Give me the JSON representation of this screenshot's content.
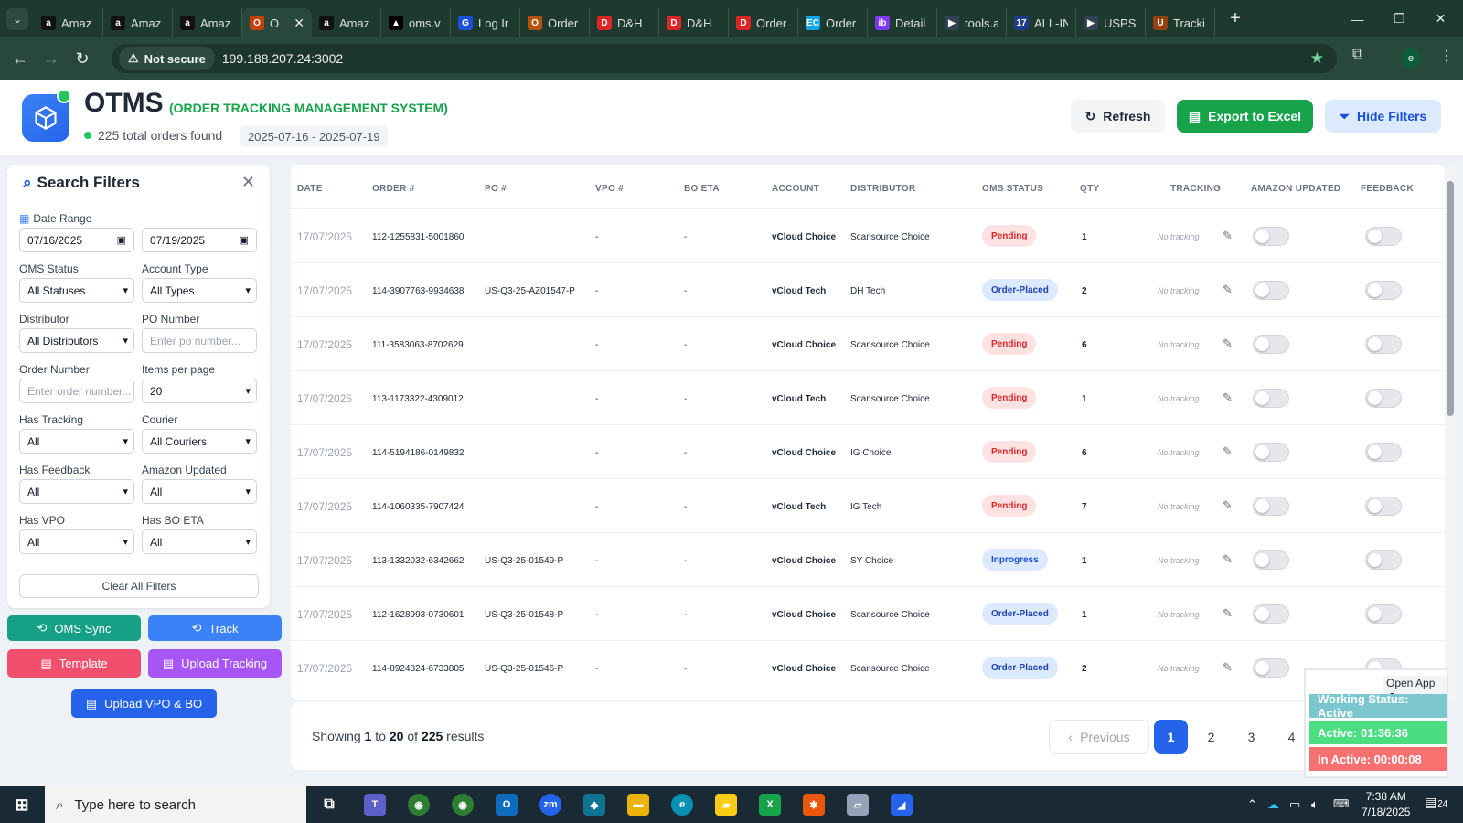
{
  "browser": {
    "tabs": [
      {
        "title": "Amaz",
        "icon": "amazon-icon",
        "color": "#111111",
        "glyph": "a"
      },
      {
        "title": "Amaz",
        "icon": "amazon-icon",
        "color": "#111111",
        "glyph": "a"
      },
      {
        "title": "Amaz",
        "icon": "amazon-icon",
        "color": "#111111",
        "glyph": "a"
      },
      {
        "title": "O",
        "icon": "otms-icon",
        "color": "#c2410c",
        "glyph": "O",
        "active": true
      },
      {
        "title": "Amaz",
        "icon": "amazon-icon",
        "color": "#111111",
        "glyph": "a"
      },
      {
        "title": "oms.v",
        "icon": "vercel-icon",
        "color": "#000000",
        "glyph": "▲"
      },
      {
        "title": "Log Ir",
        "icon": "login-icon",
        "color": "#1d4ed8",
        "glyph": "G"
      },
      {
        "title": "Order",
        "icon": "order-icon",
        "color": "#b45309",
        "glyph": "O"
      },
      {
        "title": "D&H",
        "icon": "dh-icon",
        "color": "#dc2626",
        "glyph": "D"
      },
      {
        "title": "D&H",
        "icon": "dh-icon",
        "color": "#dc2626",
        "glyph": "D"
      },
      {
        "title": "Order",
        "icon": "order-icon",
        "color": "#dc2626",
        "glyph": "D"
      },
      {
        "title": "Order",
        "icon": "ec-icon",
        "color": "#0ea5e9",
        "glyph": "EC"
      },
      {
        "title": "Detail",
        "icon": "detail-icon",
        "color": "#7c3aed",
        "glyph": "ib"
      },
      {
        "title": "tools.a",
        "icon": "tools-icon",
        "color": "#334155",
        "glyph": "▶"
      },
      {
        "title": "ALL-IN",
        "icon": "allin-icon",
        "color": "#1e3a8a",
        "glyph": "17"
      },
      {
        "title": "USPS.",
        "icon": "usps-icon",
        "color": "#334155",
        "glyph": "▶"
      },
      {
        "title": "Tracki",
        "icon": "ups-icon",
        "color": "#92400e",
        "glyph": "U"
      }
    ],
    "new_tab": "+",
    "not_secure": "Not secure",
    "url": "199.188.207.24:3002",
    "profile": "e"
  },
  "header": {
    "title": "OTMS",
    "subtitle": "(ORDER TRACKING MANAGEMENT SYSTEM)",
    "total": "225 total orders found",
    "date_range": "2025-07-16 - 2025-07-19",
    "refresh": "Refresh",
    "export": "Export to Excel",
    "hide_filters": "Hide Filters"
  },
  "filters": {
    "title": "Search Filters",
    "date_range_label": "Date Range",
    "date_from": "07/16/2025",
    "date_to": "07/19/2025",
    "oms_status_label": "OMS Status",
    "oms_status": "All Statuses",
    "account_type_label": "Account Type",
    "account_type": "All Types",
    "distributor_label": "Distributor",
    "distributor": "All Distributors",
    "po_label": "PO Number",
    "po_placeholder": "Enter po number...",
    "order_label": "Order Number",
    "order_placeholder": "Enter order number...",
    "per_page_label": "Items per page",
    "per_page": "20",
    "has_tracking_label": "Has Tracking",
    "has_tracking": "All",
    "courier_label": "Courier",
    "courier": "All Couriers",
    "has_feedback_label": "Has Feedback",
    "has_feedback": "All",
    "amazon_updated_label": "Amazon Updated",
    "amazon_updated": "All",
    "has_vpo_label": "Has VPO",
    "has_vpo": "All",
    "has_bo_eta_label": "Has BO ETA",
    "has_bo_eta": "All",
    "clear": "Clear All Filters"
  },
  "actions": {
    "oms_sync": "OMS Sync",
    "track": "Track",
    "template": "Template",
    "upload_tracking": "Upload Tracking",
    "upload_vpo": "Upload VPO & BO"
  },
  "table": {
    "columns": [
      "DATE",
      "ORDER #",
      "PO #",
      "VPO #",
      "BO ETA",
      "ACCOUNT",
      "DISTRIBUTOR",
      "OMS STATUS",
      "QTY",
      "TRACKING",
      "AMAZON UPDATED",
      "FEEDBACK"
    ],
    "no_tracking": "No tracking",
    "rows": [
      {
        "date": "17/07/2025",
        "order": "112-1255831-5001860",
        "po": "",
        "vpo": "-",
        "bo": "-",
        "account": "vCloud Choice",
        "distributor": "Scansource Choice",
        "status": "Pending",
        "qty": "1"
      },
      {
        "date": "17/07/2025",
        "order": "114-3907763-9934638",
        "po": "US-Q3-25-AZ01547-P",
        "vpo": "-",
        "bo": "-",
        "account": "vCloud Tech",
        "distributor": "DH Tech",
        "status": "Order-Placed",
        "qty": "2"
      },
      {
        "date": "17/07/2025",
        "order": "111-3583063-8702629",
        "po": "",
        "vpo": "-",
        "bo": "-",
        "account": "vCloud Choice",
        "distributor": "Scansource Choice",
        "status": "Pending",
        "qty": "6"
      },
      {
        "date": "17/07/2025",
        "order": "113-1173322-4309012",
        "po": "",
        "vpo": "-",
        "bo": "-",
        "account": "vCloud Tech",
        "distributor": "Scansource Choice",
        "status": "Pending",
        "qty": "1"
      },
      {
        "date": "17/07/2025",
        "order": "114-5194186-0149832",
        "po": "",
        "vpo": "-",
        "bo": "-",
        "account": "vCloud Choice",
        "distributor": "IG Choice",
        "status": "Pending",
        "qty": "6"
      },
      {
        "date": "17/07/2025",
        "order": "114-1060335-7907424",
        "po": "",
        "vpo": "-",
        "bo": "-",
        "account": "vCloud Tech",
        "distributor": "IG Tech",
        "status": "Pending",
        "qty": "7"
      },
      {
        "date": "17/07/2025",
        "order": "113-1332032-6342662",
        "po": "US-Q3-25-01549-P",
        "vpo": "-",
        "bo": "-",
        "account": "vCloud Choice",
        "distributor": "SY Choice",
        "status": "Inprogress",
        "qty": "1"
      },
      {
        "date": "17/07/2025",
        "order": "112-1628993-0730601",
        "po": "US-Q3-25-01548-P",
        "vpo": "-",
        "bo": "-",
        "account": "vCloud Choice",
        "distributor": "Scansource Choice",
        "status": "Order-Placed",
        "qty": "1"
      },
      {
        "date": "17/07/2025",
        "order": "114-8924824-6733805",
        "po": "US-Q3-25-01546-P",
        "vpo": "-",
        "bo": "-",
        "account": "vCloud Choice",
        "distributor": "Scansource Choice",
        "status": "Order-Placed",
        "qty": "2"
      }
    ]
  },
  "pagination": {
    "showing": "Showing",
    "from": "1",
    "to_word": "to",
    "to": "20",
    "of_word": "of",
    "total": "225",
    "results": "results",
    "previous": "Previous",
    "pages": [
      "1",
      "2",
      "3",
      "4"
    ]
  },
  "widget": {
    "open_app": "Open App ↗",
    "working": "Working Status: Active",
    "active": "Active: 01:36:36",
    "inactive": "In Active: 00:00:08"
  },
  "taskbar": {
    "search": "Type here to search",
    "time": "7:38 AM",
    "date": "7/18/2025",
    "notif": "24"
  }
}
